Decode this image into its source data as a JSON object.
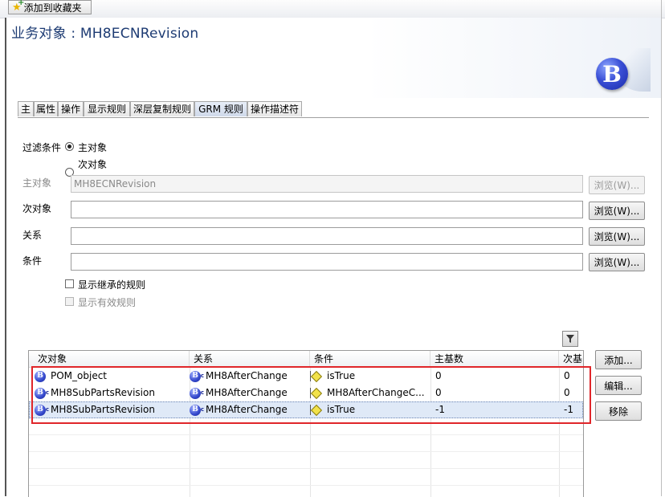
{
  "toolbar": {
    "add_favorites_label": "添加到收藏夹"
  },
  "page": {
    "title": "业务对象 : MH8ECNRevision"
  },
  "tabs": [
    {
      "label": "主"
    },
    {
      "label": "属性"
    },
    {
      "label": "操作"
    },
    {
      "label": "显示规则"
    },
    {
      "label": "深层复制规则"
    },
    {
      "label": "GRM 规则",
      "active": true
    },
    {
      "label": "操作描述符"
    }
  ],
  "filter": {
    "label": "过滤条件",
    "radio_primary": "主对象",
    "radio_secondary": "次对象",
    "selected": "primary"
  },
  "fields": {
    "primary_label": "主对象",
    "primary_value": "MH8ECNRevision",
    "secondary_label": "次对象",
    "secondary_value": "",
    "relation_label": "关系",
    "relation_value": "",
    "condition_label": "条件",
    "condition_value": "",
    "browse_label": "浏览(W)..."
  },
  "checkboxes": {
    "show_inherited": "显示继承的规则",
    "show_effective": "显示有效规则"
  },
  "table": {
    "columns": [
      "次对象",
      "关系",
      "条件",
      "主基数",
      "次基"
    ],
    "rows": [
      {
        "secondary": "POM_object",
        "relation": "MH8AfterChange",
        "condition": "isTrue",
        "primary_card": "0",
        "secondary_card": "0",
        "selected": false
      },
      {
        "secondary": "MH8SubPartsRevision",
        "relation": "MH8AfterChange",
        "condition": "MH8AfterChangeC...",
        "primary_card": "0",
        "secondary_card": "0",
        "selected": false
      },
      {
        "secondary": "MH8SubPartsRevision",
        "relation": "MH8AfterChange",
        "condition": "isTrue",
        "primary_card": "-1",
        "secondary_card": "-1",
        "selected": true
      }
    ]
  },
  "actions": {
    "add_label": "添加...",
    "edit_label": "编辑...",
    "remove_label": "移除"
  },
  "colors": {
    "title": "#1d3b73",
    "highlight_box": "#e0262a",
    "selected_row": "#dfe9f7"
  }
}
